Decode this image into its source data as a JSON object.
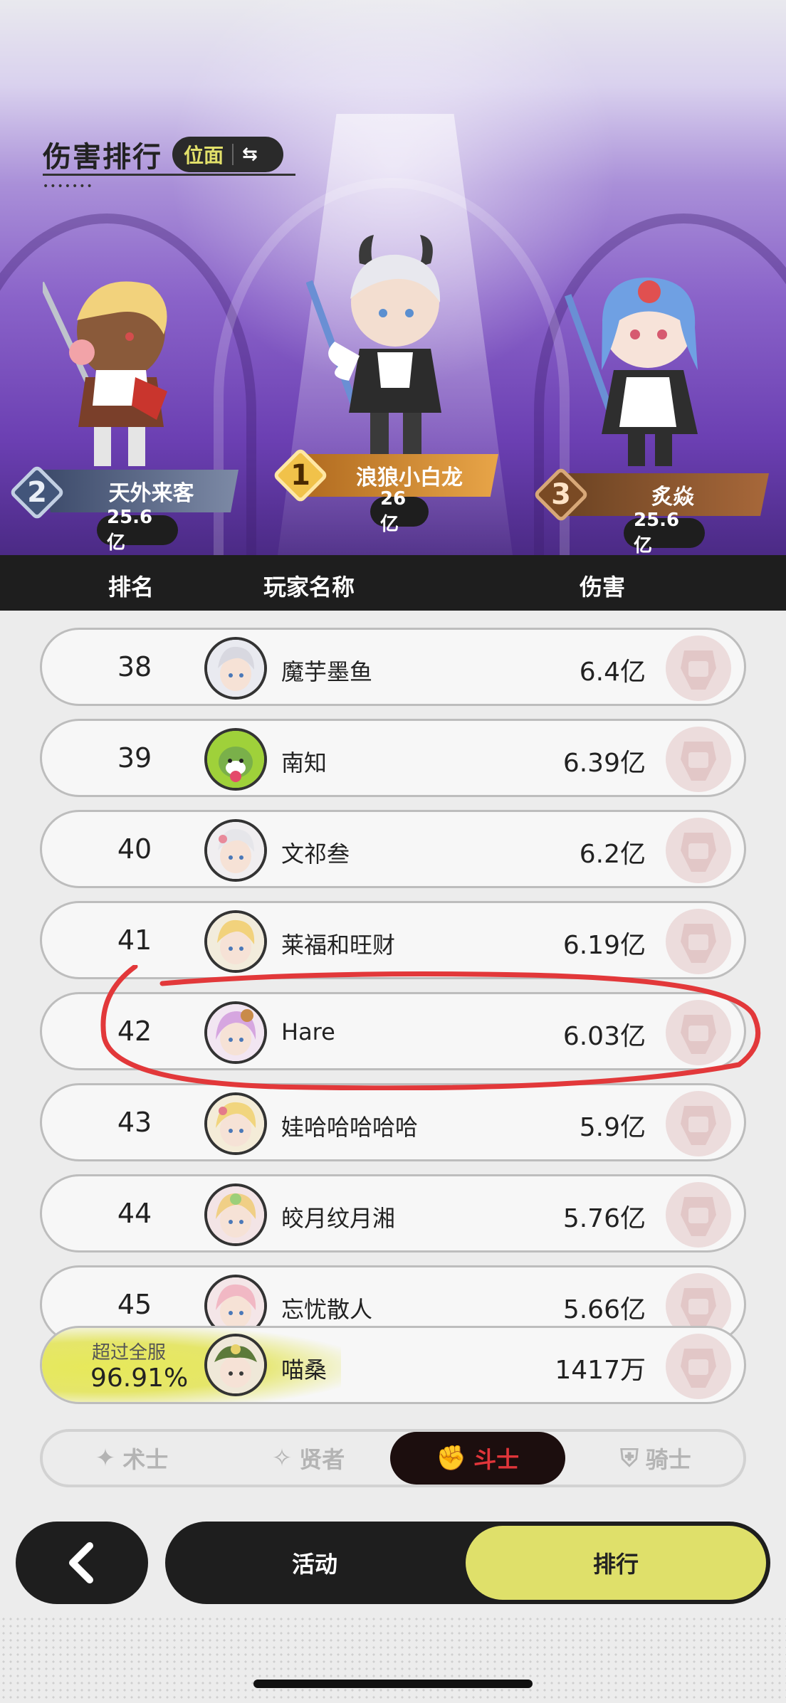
{
  "header": {
    "title": "伤害排行",
    "switch_label": "位面",
    "switch_icon": "⇆"
  },
  "podium": [
    {
      "rank": "2",
      "name": "天外来客",
      "damage": "25.6亿"
    },
    {
      "rank": "1",
      "name": "浪狼小白龙",
      "damage": "26亿"
    },
    {
      "rank": "3",
      "name": "炙焱",
      "damage": "25.6亿"
    }
  ],
  "table_header": {
    "rank": "排名",
    "player": "玩家名称",
    "damage": "伤害"
  },
  "rows": [
    {
      "rank": "38",
      "name": "魔芋墨鱼",
      "damage": "6.4亿"
    },
    {
      "rank": "39",
      "name": "南知",
      "damage": "6.39亿"
    },
    {
      "rank": "40",
      "name": "文祁叁",
      "damage": "6.2亿"
    },
    {
      "rank": "41",
      "name": "莱福和旺财",
      "damage": "6.19亿"
    },
    {
      "rank": "42",
      "name": "Hare",
      "damage": "6.03亿"
    },
    {
      "rank": "43",
      "name": "娃哈哈哈哈哈",
      "damage": "5.9亿"
    },
    {
      "rank": "44",
      "name": "皎月纹月湘",
      "damage": "5.76亿"
    },
    {
      "rank": "45",
      "name": "忘忧散人",
      "damage": "5.66亿"
    }
  ],
  "mine": {
    "over_label": "超过全服",
    "percent": "96.91%",
    "name": "喵桑",
    "damage": "1417万"
  },
  "class_tabs": [
    {
      "label": "术士",
      "icon": "warlock-icon",
      "active": false
    },
    {
      "label": "贤者",
      "icon": "sage-icon",
      "active": false
    },
    {
      "label": "斗士",
      "icon": "fighter-icon",
      "active": true
    },
    {
      "label": "骑士",
      "icon": "knight-icon",
      "active": false
    }
  ],
  "bottom_nav": {
    "back_icon": "chevron-left-icon",
    "activity": "活动",
    "ranking": "排行"
  },
  "colors": {
    "accent_yellow": "#dfe06a",
    "active_tab_red": "#e0353a",
    "dark": "#1e1e1e",
    "annotation_red": "#e2383a"
  }
}
